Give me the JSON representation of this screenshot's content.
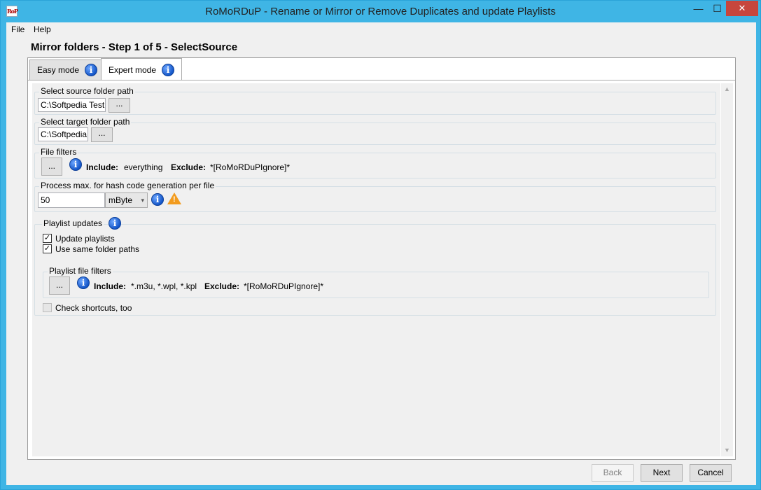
{
  "window": {
    "title": "RoMoRDuP - Rename or Mirror or Remove Duplicates and update Playlists",
    "minimize": "—",
    "maximize": "☐",
    "close": "✕",
    "icon_text": "RoP"
  },
  "menu": {
    "items": [
      "File",
      "Help"
    ]
  },
  "heading": "Mirror folders - Step 1 of 5 - SelectSource",
  "tabs": [
    {
      "label": "Easy mode",
      "icon": "info-icon",
      "selected": false
    },
    {
      "label": "Expert mode",
      "icon": "info-icon",
      "selected": true
    }
  ],
  "source": {
    "title": "Select source folder path",
    "value": "C:\\Softpedia Test",
    "browse_label": "..."
  },
  "target": {
    "title": "Select target folder path",
    "value": "C:\\Softpedia",
    "browse_label": "..."
  },
  "file_filters": {
    "title": "File filters",
    "button_label": "...",
    "include_label": "Include:",
    "include_value": "everything",
    "exclude_label": "Exclude:",
    "exclude_value": "*[RoMoRDuPIgnore]*"
  },
  "hash": {
    "title": "Process max. for hash code generation per file",
    "value": "50",
    "unit": "mByte"
  },
  "playlist": {
    "title": "Playlist updates",
    "update_label": "Update playlists",
    "update_checked": true,
    "same_paths_label": "Use same folder paths",
    "same_paths_checked": true,
    "filters": {
      "title": "Playlist file filters",
      "button_label": "...",
      "include_label": "Include:",
      "include_value": "*.m3u, *.wpl, *.kpl",
      "exclude_label": "Exclude:",
      "exclude_value": "*[RoMoRDuPIgnore]*"
    },
    "shortcuts_label": "Check shortcuts, too",
    "shortcuts_checked": false
  },
  "footer": {
    "back_label": "Back",
    "next_label": "Next",
    "cancel_label": "Cancel"
  },
  "colors": {
    "titlebar": "#3fb5e5",
    "close_button": "#c7463d",
    "info_icon": "#1456c8",
    "warning_icon": "#f29b1e"
  }
}
